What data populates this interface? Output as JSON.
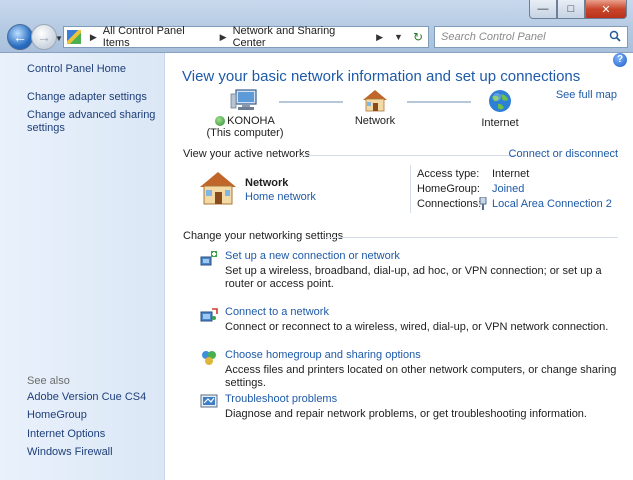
{
  "titlebar": {
    "minimize": "—",
    "maximize": "□",
    "close": "✕"
  },
  "nav": {
    "back": "←",
    "forward": "→",
    "dropdown": "▼"
  },
  "address": {
    "crumbs": [
      "All Control Panel Items",
      "Network and Sharing Center"
    ],
    "sep": "▶",
    "dropdown": "▼",
    "refresh": "↻"
  },
  "search": {
    "placeholder": "Search Control Panel",
    "icon": "search-icon"
  },
  "sidebar": {
    "home": "Control Panel Home",
    "adapter": "Change adapter settings",
    "sharing_line1": "Change advanced sharing",
    "sharing_line2": "settings",
    "see_also": "See also",
    "links": [
      "Adobe Version Cue CS4",
      "HomeGroup",
      "Internet Options",
      "Windows Firewall"
    ]
  },
  "main": {
    "help": "?",
    "heading": "View your basic network information and set up connections",
    "see_full_map": "See full map",
    "map": {
      "computer": "KONOHA",
      "computer_sub": "(This computer)",
      "network": "Network",
      "internet": "Internet"
    },
    "active_header": "View your active networks",
    "connect_link": "Connect or disconnect",
    "network_name": "Network",
    "network_type": "Home network",
    "access_label": "Access type:",
    "access_value": "Internet",
    "homegroup_label": "HomeGroup:",
    "homegroup_value": "Joined",
    "connections_label": "Connections:",
    "connections_value": "Local Area Connection 2",
    "change_header": "Change your networking settings",
    "tasks": [
      {
        "title": "Set up a new connection or network",
        "desc": "Set up a wireless, broadband, dial-up, ad hoc, or VPN connection; or set up a router or access point."
      },
      {
        "title": "Connect to a network",
        "desc": "Connect or reconnect to a wireless, wired, dial-up, or VPN network connection."
      },
      {
        "title": "Choose homegroup and sharing options",
        "desc": "Access files and printers located on other network computers, or change sharing settings."
      },
      {
        "title": "Troubleshoot problems",
        "desc": "Diagnose and repair network problems, or get troubleshooting information."
      }
    ]
  }
}
